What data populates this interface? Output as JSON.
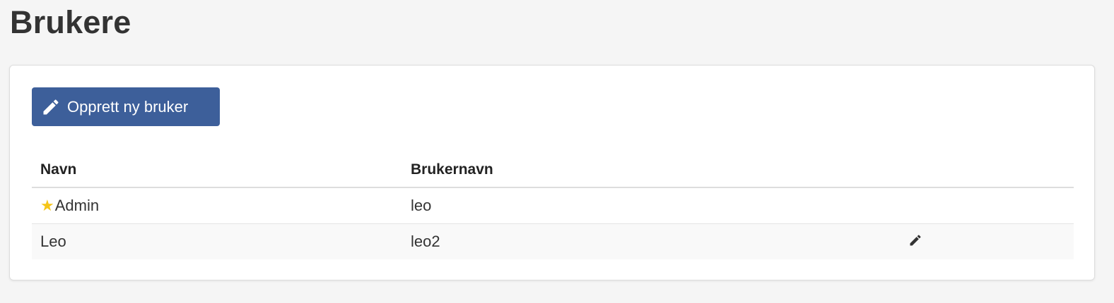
{
  "page": {
    "title": "Brukere"
  },
  "toolbar": {
    "create_user_label": "Opprett ny bruker",
    "create_icon": "pencil-icon"
  },
  "table": {
    "columns": {
      "name": "Navn",
      "username": "Brukernavn"
    },
    "rows": [
      {
        "name": "Admin",
        "username": "leo",
        "badge_icon": "star-icon",
        "editable": false
      },
      {
        "name": "Leo",
        "username": "leo2",
        "editable": true,
        "action_icon": "pencil-icon"
      }
    ]
  },
  "colors": {
    "primary_button": "#3d5f9a",
    "star": "#f5c518",
    "background": "#f5f5f5"
  }
}
